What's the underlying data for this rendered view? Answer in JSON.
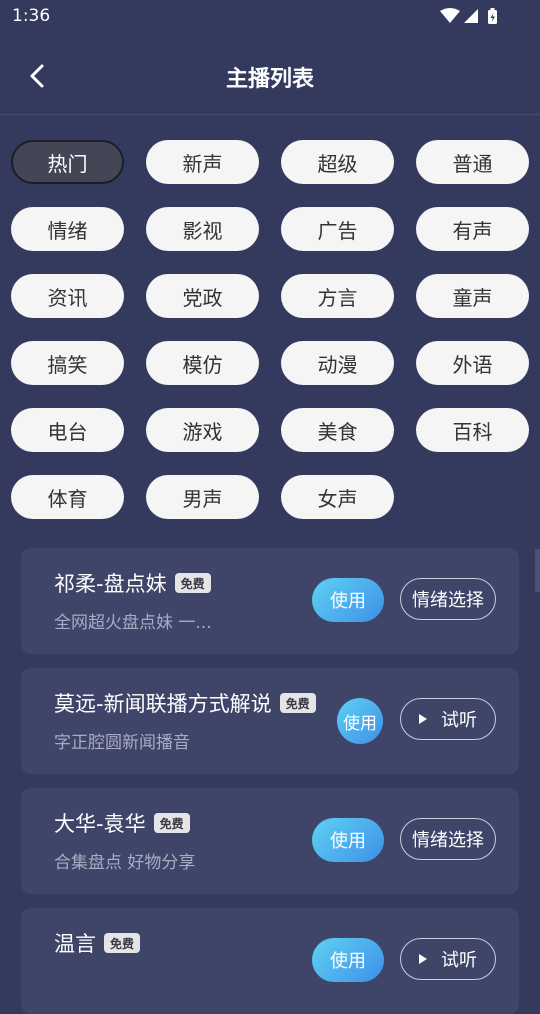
{
  "status": {
    "time": "1:36"
  },
  "header": {
    "title": "主播列表"
  },
  "categories": [
    "热门",
    "新声",
    "超级",
    "普通",
    "情绪",
    "影视",
    "广告",
    "有声",
    "资讯",
    "党政",
    "方言",
    "童声",
    "搞笑",
    "模仿",
    "动漫",
    "外语",
    "电台",
    "游戏",
    "美食",
    "百科",
    "体育",
    "男声",
    "女声"
  ],
  "active_category": "热门",
  "anchors": [
    {
      "name": "祁柔-盘点妹",
      "badge": "免费",
      "desc": "全网超火盘点妹 一...",
      "use_label": "使用",
      "action_label": "情绪选择"
    },
    {
      "name": "莫远-新闻联播方式解说",
      "badge": "免费",
      "desc": "字正腔圆新闻播音",
      "use_label": "使用",
      "action_label": "试听"
    },
    {
      "name": "大华-袁华",
      "badge": "免费",
      "desc": "合集盘点 好物分享",
      "use_label": "使用",
      "action_label": "情绪选择"
    },
    {
      "name": "温言",
      "badge": "免费",
      "desc": "",
      "use_label": "使用",
      "action_label": "试听"
    }
  ]
}
